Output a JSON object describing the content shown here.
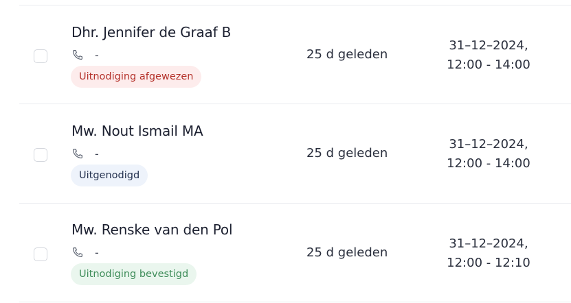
{
  "contacts": [
    {
      "name": "Dhr. Jennifer de Graaf B",
      "phone": "-",
      "status": "Uitnodiging afgewezen",
      "status_type": "declined",
      "status_color": "#b5332c",
      "updated": "25 d geleden",
      "date": "31–12–2024,",
      "time": "12:00 - 14:00"
    },
    {
      "name": "Mw. Nout Ismail MA",
      "phone": "-",
      "status": "Uitgenodigd",
      "status_type": "invited",
      "status_color": "#24314f",
      "updated": "25 d geleden",
      "date": "31–12–2024,",
      "time": "12:00 - 14:00"
    },
    {
      "name": "Mw. Renske van den Pol",
      "phone": "-",
      "status": "Uitnodiging bevestigd",
      "status_type": "confirmed",
      "status_color": "#3f8d5a",
      "updated": "25 d geleden",
      "date": "31–12–2024,",
      "time": "12:00 - 12:10"
    }
  ],
  "icons": {
    "phone": "phone-icon"
  }
}
